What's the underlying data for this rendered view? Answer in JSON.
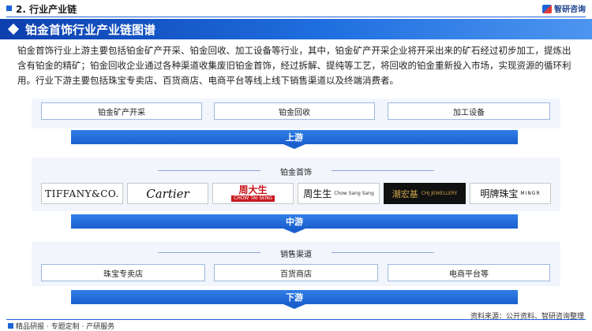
{
  "header": {
    "section": "2. 行业产业链",
    "brand": "智研咨询"
  },
  "title": "铂金首饰行业产业链图谱",
  "description": "铂金首饰行业上游主要包括铂金矿产开采、铂金回收、加工设备等行业，其中，铂金矿产开采企业将开采出来的矿石经过初步加工，提炼出含有铂金的精矿；铂金回收企业通过各种渠道收集废旧铂金首饰，经过拆解、提纯等工艺，将回收的铂金重新投入市场，实现资源的循环利用。行业下游主要包括珠宝专卖店、百货商店、电商平台等线上线下销售渠道以及终端消费者。",
  "upstream": {
    "items": [
      "铂金矿产开采",
      "铂金回收",
      "加工设备"
    ],
    "label": "上游"
  },
  "midstream": {
    "title": "铂金首饰",
    "brands": [
      "TIFFANY&CO.",
      "Cartier",
      "周大生",
      "CHOW TAI SENG",
      "周生生",
      "Chow Sang Sang",
      "潮宏基",
      "CHJ JEWELLERY",
      "明牌珠宝",
      "MINGR"
    ],
    "label": "中游"
  },
  "downstream": {
    "title": "销售渠道",
    "items": [
      "珠宝专卖店",
      "百货商店",
      "电商平台等"
    ],
    "label": "下游"
  },
  "footer": {
    "left": "精品研报 · 专题定制 · 产研服务",
    "source": "资料来源：公开资料、智研咨询整理"
  }
}
